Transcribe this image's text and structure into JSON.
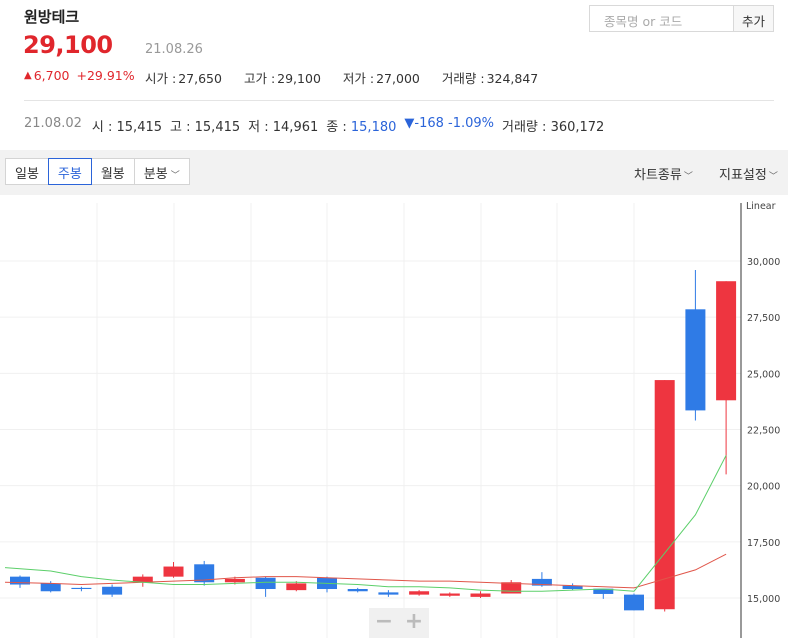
{
  "stock": {
    "name": "원방테크",
    "price": "29,100",
    "date": "21.08.26",
    "change": "6,700",
    "change_pct": "+29.91%",
    "stats": [
      {
        "label": "시가",
        "value": "27,650"
      },
      {
        "label": "고가",
        "value": "29,100"
      },
      {
        "label": "저가",
        "value": "27,000"
      },
      {
        "label": "거래량",
        "value": "324,847"
      }
    ]
  },
  "search": {
    "placeholder": "종목명 or 코드",
    "add_label": "추가"
  },
  "week": {
    "date": "21.08.02",
    "open_label": "시",
    "open": "15,415",
    "high_label": "고",
    "high": "15,415",
    "low_label": "저",
    "low": "14,961",
    "close_label": "종",
    "close": "15,180",
    "change": "▼-168 -1.09%",
    "volume_label": "거래량",
    "volume": "360,172"
  },
  "toolbar": {
    "tabs": [
      "일봉",
      "주봉",
      "월봉",
      "분봉"
    ],
    "active_tab": "주봉",
    "chart_type_label": "차트종류",
    "indicator_label": "지표설정"
  },
  "colors": {
    "up": "#ee3540",
    "down": "#2f7be6",
    "ma_short": "#5ccf6a",
    "ma_long": "#e0564a",
    "accent": "#2b64d9"
  },
  "chart_data": {
    "type": "candlestick",
    "scale_label": "Linear",
    "ylim": [
      13800,
      31500
    ],
    "y_ticks": [
      15000,
      17500,
      20000,
      22500,
      25000,
      27500,
      30000
    ],
    "y_tick_labels": [
      "15,000",
      "17,500",
      "20,000",
      "22,500",
      "25,000",
      "27,500",
      "30,000"
    ],
    "candles": [
      {
        "open": 15950,
        "close": 15600,
        "high": 16000,
        "low": 15450
      },
      {
        "open": 15650,
        "close": 15300,
        "high": 15750,
        "low": 15250
      },
      {
        "open": 15450,
        "close": 15400,
        "high": 15500,
        "low": 15300
      },
      {
        "open": 15500,
        "close": 15150,
        "high": 15600,
        "low": 15050
      },
      {
        "open": 15700,
        "close": 15950,
        "high": 16050,
        "low": 15500
      },
      {
        "open": 15950,
        "close": 16400,
        "high": 16600,
        "low": 15900
      },
      {
        "open": 16500,
        "close": 15700,
        "high": 16650,
        "low": 15550
      },
      {
        "open": 15700,
        "close": 15850,
        "high": 15950,
        "low": 15600
      },
      {
        "open": 15900,
        "close": 15400,
        "high": 15950,
        "low": 15050
      },
      {
        "open": 15350,
        "close": 15650,
        "high": 15750,
        "low": 15300
      },
      {
        "open": 15900,
        "close": 15400,
        "high": 15950,
        "low": 15250
      },
      {
        "open": 15400,
        "close": 15300,
        "high": 15450,
        "low": 15250
      },
      {
        "open": 15250,
        "close": 15150,
        "high": 15350,
        "low": 15050
      },
      {
        "open": 15150,
        "close": 15300,
        "high": 15350,
        "low": 15100
      },
      {
        "open": 15100,
        "close": 15200,
        "high": 15250,
        "low": 15050
      },
      {
        "open": 15050,
        "close": 15200,
        "high": 15300,
        "low": 15000
      },
      {
        "open": 15200,
        "close": 15700,
        "high": 15800,
        "low": 15200
      },
      {
        "open": 15850,
        "close": 15550,
        "high": 16150,
        "low": 15500
      },
      {
        "open": 15550,
        "close": 15400,
        "high": 15650,
        "low": 15350
      },
      {
        "open": 15415,
        "close": 15180,
        "high": 15415,
        "low": 14961
      },
      {
        "open": 15150,
        "close": 14450,
        "high": 15200,
        "low": 14450
      },
      {
        "open": 14500,
        "close": 24700,
        "high": 24700,
        "low": 14400
      },
      {
        "open": 27850,
        "close": 23350,
        "high": 29600,
        "low": 22900
      },
      {
        "open": 23800,
        "close": 29100,
        "high": 29100,
        "low": 20500
      }
    ],
    "ma_short": [
      16350,
      16200,
      15950,
      15800,
      15700,
      15600,
      15600,
      15650,
      15700,
      15700,
      15650,
      15600,
      15500,
      15500,
      15450,
      15350,
      15300,
      15300,
      15350,
      15400,
      15300,
      17000,
      18700,
      21350
    ],
    "ma_long": [
      15700,
      15650,
      15600,
      15650,
      15700,
      15750,
      15800,
      15900,
      15950,
      15950,
      15900,
      15850,
      15800,
      15750,
      15750,
      15700,
      15650,
      15600,
      15550,
      15500,
      15450,
      15850,
      16250,
      16950
    ]
  }
}
